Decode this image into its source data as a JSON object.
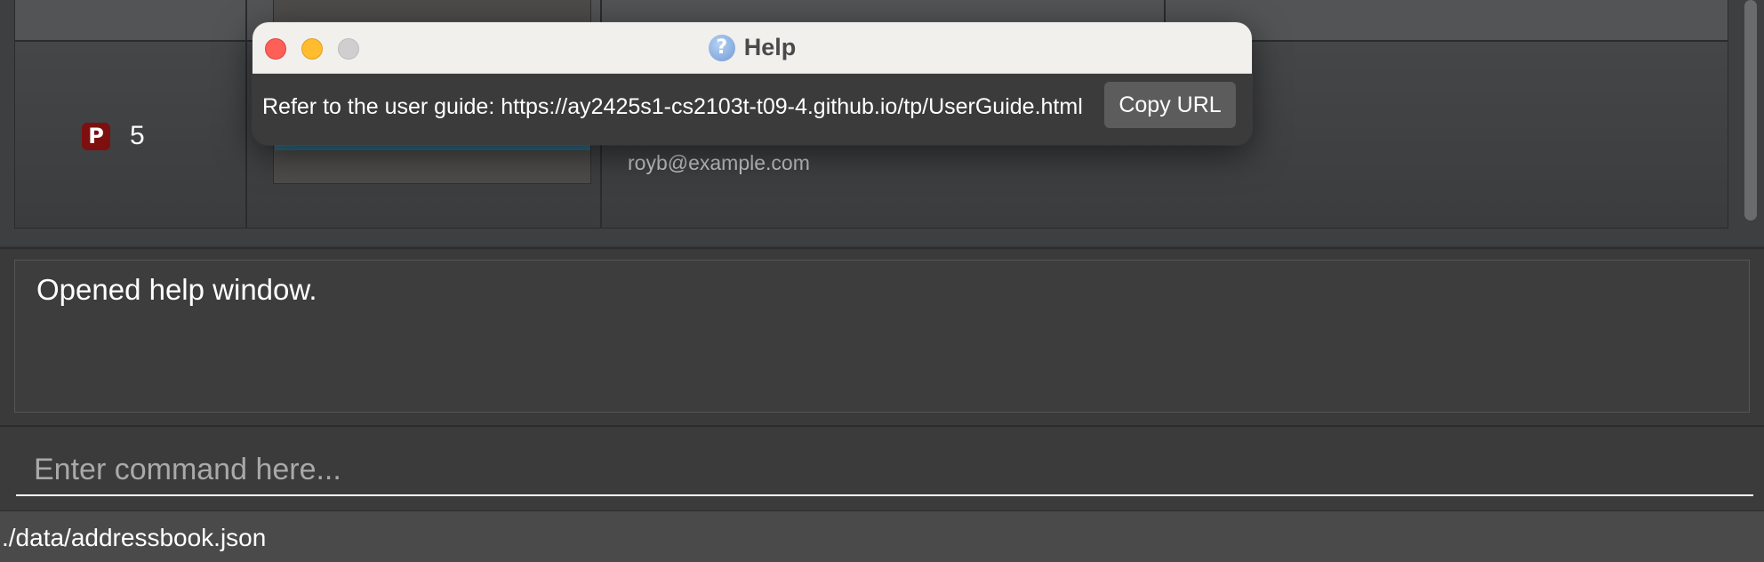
{
  "contact_list": {
    "index": "5",
    "priority_badge": "P",
    "email": "royb@example.com"
  },
  "result_display": {
    "message": "Opened help window."
  },
  "command_box": {
    "placeholder": "Enter command here..."
  },
  "status_bar": {
    "file_path": "./data/addressbook.json"
  },
  "help_window": {
    "title": "Help",
    "title_icon": "?",
    "message": "Refer to the user guide: https://ay2425s1-cs2103t-t09-4.github.io/tp/UserGuide.html",
    "copy_button_label": "Copy URL"
  },
  "colors": {
    "priority_badge": "#7e0f0f",
    "close_button": "#fe5f57",
    "minimize_button": "#febc2e",
    "zoom_button_disabled": "#cfcfcf",
    "selection_accent": "#2f6d86"
  }
}
